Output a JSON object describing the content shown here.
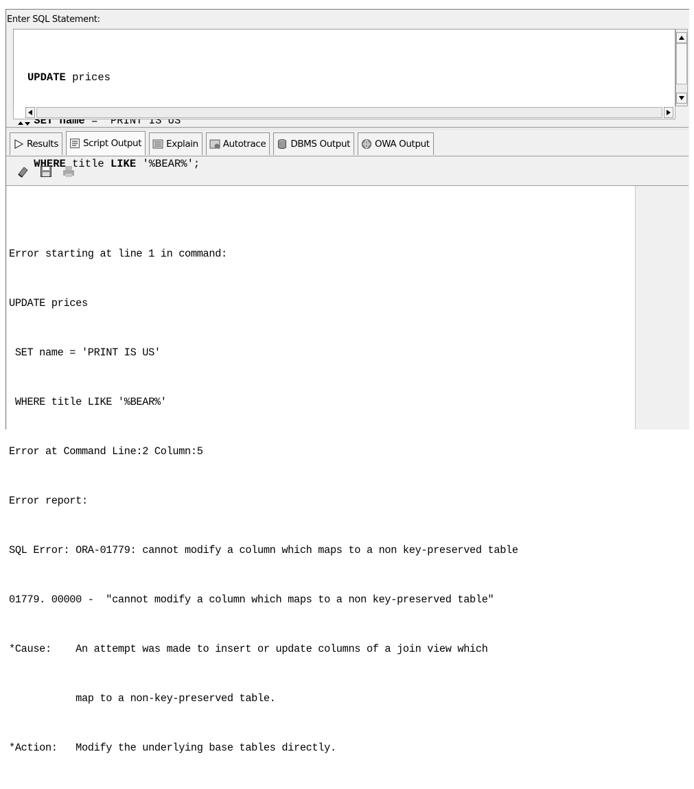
{
  "editor": {
    "label": "Enter SQL Statement:",
    "lines": [
      {
        "kw": "UPDATE",
        "rest": " prices"
      },
      {
        "kw": " SET",
        "rest_pre": " ",
        "kw2": "name",
        "rest": " = 'PRINT IS US'"
      },
      {
        "kw": " WHERE",
        "rest": " title ",
        "kw2": "LIKE",
        "rest2": " '%BEAR%';"
      }
    ]
  },
  "tabs": [
    {
      "label": "Results",
      "icon": "play-icon"
    },
    {
      "label": "Script Output",
      "icon": "script-icon"
    },
    {
      "label": "Explain",
      "icon": "explain-icon"
    },
    {
      "label": "Autotrace",
      "icon": "autotrace-icon"
    },
    {
      "label": "DBMS Output",
      "icon": "dbms-icon"
    },
    {
      "label": "OWA Output",
      "icon": "owa-icon"
    }
  ],
  "toolbar": [
    {
      "icon": "eraser-icon"
    },
    {
      "icon": "save-icon"
    },
    {
      "icon": "print-icon"
    }
  ],
  "output": {
    "lines": [
      "Error starting at line 1 in command:",
      "UPDATE prices",
      " SET name = 'PRINT IS US'",
      " WHERE title LIKE '%BEAR%'",
      "Error at Command Line:2 Column:5",
      "Error report:",
      "SQL Error: ORA-01779: cannot modify a column which maps to a non key-preserved table",
      "01779. 00000 -  \"cannot modify a column which maps to a non key-preserved table\"",
      "*Cause:    An attempt was made to insert or update columns of a join view which",
      "           map to a non-key-preserved table.",
      "*Action:   Modify the underlying base tables directly."
    ]
  }
}
